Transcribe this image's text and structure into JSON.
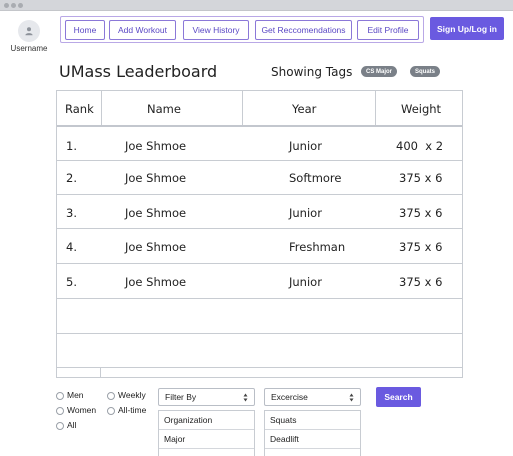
{
  "user": {
    "label": "Username",
    "icon": "user-icon"
  },
  "nav": {
    "items": [
      {
        "label": "Home"
      },
      {
        "label": "Add Workout"
      },
      {
        "label": "View History"
      },
      {
        "label": "Get Reccomendations"
      },
      {
        "label": "Edit Profile"
      }
    ],
    "signup_label": "Sign Up/Log in"
  },
  "leaderboard": {
    "title": "UMass Leaderboard",
    "tags_label": "Showing Tags",
    "tags": [
      "CS Major",
      "Squats"
    ]
  },
  "table": {
    "headers": [
      "Rank",
      "Name",
      "Year",
      "Weight"
    ],
    "rows": [
      {
        "rank": "1.",
        "name": "Joe Shmoe",
        "year": "Junior",
        "weight": "400  x 2"
      },
      {
        "rank": "2.",
        "name": "Joe Shmoe",
        "year": "Softmore",
        "weight": "375 x 6"
      },
      {
        "rank": "3.",
        "name": "Joe Shmoe",
        "year": "Junior",
        "weight": "375 x 6"
      },
      {
        "rank": "4.",
        "name": "Joe Shmoe",
        "year": "Freshman",
        "weight": "375 x 6"
      },
      {
        "rank": "5.",
        "name": "Joe Shmoe",
        "year": "Junior",
        "weight": "375 x 6"
      }
    ]
  },
  "filters": {
    "gender_options": [
      "Men",
      "Women",
      "All"
    ],
    "time_options": [
      "Weekly",
      "All-time"
    ],
    "filter_by": {
      "value": "Filter By",
      "options": [
        "Organization",
        "Major"
      ]
    },
    "exercise": {
      "value": "Excercise",
      "options": [
        "Squats",
        "Deadlift"
      ]
    },
    "search_label": "Search"
  },
  "colors": {
    "accent": "#6a5ae0",
    "tag_bg": "#7a8088",
    "nav_border": "#8b78d8"
  }
}
